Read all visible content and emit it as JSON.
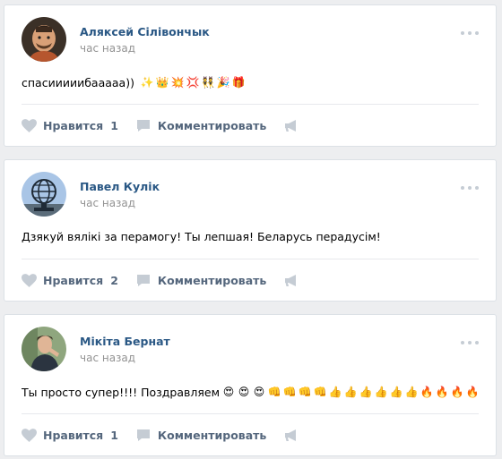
{
  "posts": [
    {
      "author": "Аляксей Сілівончык",
      "time": "час назад",
      "text": "спасииииибааааа))",
      "emojis": [
        "✨",
        "👑",
        "💥",
        "💢",
        "👯",
        "🎉",
        "🎁"
      ],
      "like_label": "Нравится",
      "like_count": "1",
      "comment_label": "Комментировать"
    },
    {
      "author": "Павел Кулік",
      "time": "час назад",
      "text": "Дзякуй вялікі за перамогу! Ты лепшая! Беларусь перадусім!",
      "emojis": [],
      "like_label": "Нравится",
      "like_count": "2",
      "comment_label": "Комментировать"
    },
    {
      "author": "Мікіта Бернат",
      "time": "час назад",
      "text": "Ты просто супер!!!! Поздравляем",
      "emojis": [
        "😍",
        "😍",
        "😍",
        "👊",
        "👊",
        "👊",
        "👊",
        "👍",
        "👍",
        "👍",
        "👍",
        "👍",
        "👍",
        "🔥",
        "🔥",
        "🔥",
        "🔥"
      ],
      "like_label": "Нравится",
      "like_count": "1",
      "comment_label": "Комментировать"
    }
  ],
  "colors": {
    "author_link": "#2a5885",
    "muted": "#939393",
    "action": "#55677d",
    "icon": "#c5ccd4",
    "page_bg": "#edeef0"
  }
}
